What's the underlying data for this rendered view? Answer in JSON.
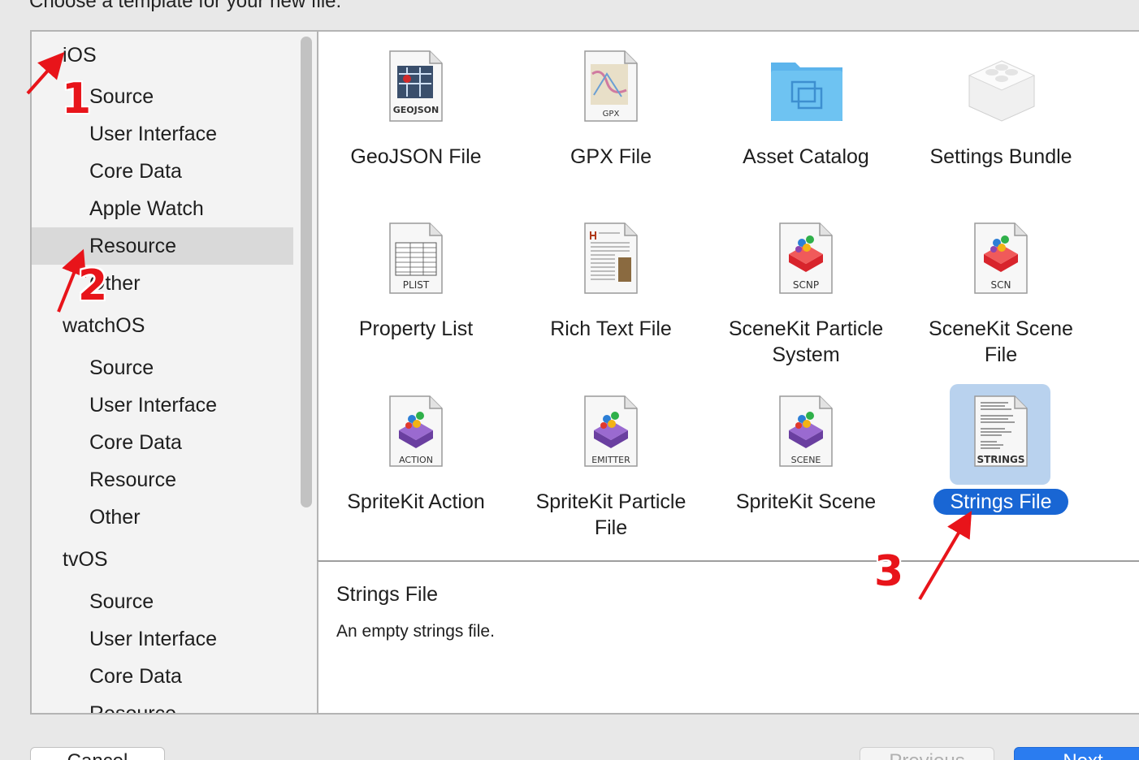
{
  "dialog": {
    "heading": "Choose a template for your new file:"
  },
  "sidebar": {
    "items": [
      {
        "label": "iOS",
        "kind": "platform"
      },
      {
        "label": "Source",
        "kind": "sub"
      },
      {
        "label": "User Interface",
        "kind": "sub"
      },
      {
        "label": "Core Data",
        "kind": "sub"
      },
      {
        "label": "Apple Watch",
        "kind": "sub"
      },
      {
        "label": "Resource",
        "kind": "sub",
        "selected": true
      },
      {
        "label": "Other",
        "kind": "sub"
      },
      {
        "label": "watchOS",
        "kind": "platform"
      },
      {
        "label": "Source",
        "kind": "sub"
      },
      {
        "label": "User Interface",
        "kind": "sub"
      },
      {
        "label": "Core Data",
        "kind": "sub"
      },
      {
        "label": "Resource",
        "kind": "sub"
      },
      {
        "label": "Other",
        "kind": "sub"
      },
      {
        "label": "tvOS",
        "kind": "platform"
      },
      {
        "label": "Source",
        "kind": "sub"
      },
      {
        "label": "User Interface",
        "kind": "sub"
      },
      {
        "label": "Core Data",
        "kind": "sub"
      },
      {
        "label": "Resource",
        "kind": "sub"
      }
    ]
  },
  "templates": [
    {
      "label": "GeoJSON File",
      "badge": "GEOJSON",
      "icon": "geojson-file-icon"
    },
    {
      "label": "GPX File",
      "badge": "GPX",
      "icon": "gpx-file-icon"
    },
    {
      "label": "Asset Catalog",
      "badge": "",
      "icon": "asset-catalog-folder-icon"
    },
    {
      "label": "Settings Bundle",
      "badge": "",
      "icon": "settings-bundle-icon"
    },
    {
      "label": "Property List",
      "badge": "PLIST",
      "icon": "property-list-icon"
    },
    {
      "label": "Rich Text File",
      "badge": "",
      "icon": "rich-text-file-icon"
    },
    {
      "label": "SceneKit Particle System",
      "badge": "SCNP",
      "icon": "scenekit-particle-icon"
    },
    {
      "label": "SceneKit Scene File",
      "badge": "SCN",
      "icon": "scenekit-scene-icon"
    },
    {
      "label": "SpriteKit Action",
      "badge": "ACTION",
      "icon": "spritekit-action-icon"
    },
    {
      "label": "SpriteKit Particle File",
      "badge": "EMITTER",
      "icon": "spritekit-particle-icon"
    },
    {
      "label": "SpriteKit Scene",
      "badge": "SCENE",
      "icon": "spritekit-scene-icon"
    },
    {
      "label": "Strings File",
      "badge": "STRINGS",
      "icon": "strings-file-icon",
      "selected": true
    }
  ],
  "description": {
    "title": "Strings File",
    "text": "An empty strings file."
  },
  "buttons": {
    "cancel": "Cancel",
    "previous": "Previous",
    "next": "Next"
  },
  "annotations": [
    "1",
    "2",
    "3"
  ],
  "colors": {
    "selection_blue": "#1966d4",
    "selection_icon_bg": "#b9d2ee",
    "annotation_red": "#e8141a"
  }
}
